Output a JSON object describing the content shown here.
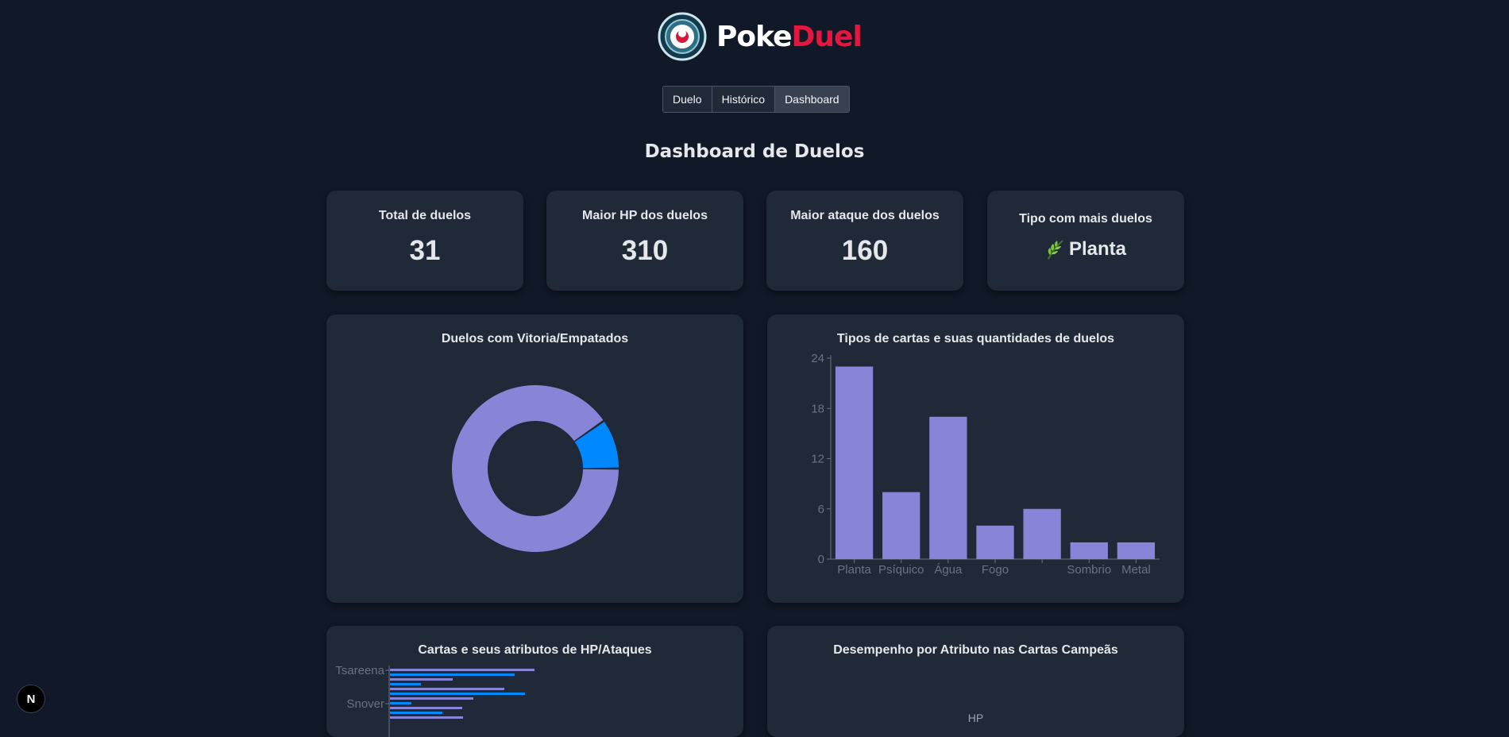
{
  "brand": {
    "poke": "Poke",
    "duel": "Duel"
  },
  "nav": {
    "tabs": [
      "Duelo",
      "Histórico",
      "Dashboard"
    ],
    "active": "Dashboard"
  },
  "page_title": "Dashboard de Duelos",
  "stats": {
    "total_label": "Total de duelos",
    "total_value": "31",
    "hp_label": "Maior HP dos duelos",
    "hp_value": "310",
    "attack_label": "Maior ataque dos duelos",
    "attack_value": "160",
    "type_label": "Tipo com mais duelos",
    "type_value": "Planta",
    "type_icon": "leaf-icon"
  },
  "charts": {
    "donut_title": "Duelos com Vitoria/Empatados",
    "bar_title": "Tipos de cartas e suas quantidades de duelos",
    "hbar_title": "Cartas e seus atributos de HP/Ataques",
    "radar_title": "Desempenho por Atributo nas Cartas Campeãs",
    "radar_axis_label": "HP"
  },
  "colors": {
    "primary": "#8884d8",
    "secondary": "#0088fe",
    "accent": "#e5173f",
    "card_bg": "#1f2937",
    "page_bg": "#111827"
  },
  "chart_data": [
    {
      "type": "pie",
      "title": "Duelos com Vitoria/Empatados",
      "slices": [
        {
          "value": 28
        },
        {
          "value": 3
        }
      ],
      "colors": [
        "#8884d8",
        "#0088fe"
      ],
      "donut": true
    },
    {
      "type": "bar",
      "title": "Tipos de cartas e suas quantidades de duelos",
      "categories": [
        "Planta",
        "Psíquico",
        "Água",
        "Fogo",
        "",
        "Sombrio",
        "Metal"
      ],
      "values": [
        23,
        8,
        17,
        4,
        6,
        2,
        2
      ],
      "yticks": [
        "0",
        "6",
        "12",
        "18",
        "24"
      ],
      "ylim": [
        0,
        24
      ],
      "color": "#8884d8"
    },
    {
      "type": "bar",
      "orientation": "horizontal",
      "title": "Cartas e seus atributos de HP/Ataques",
      "ylabels": [
        "Tsareena",
        "Snover"
      ],
      "colors": [
        "#8884d8",
        "#0088fe"
      ]
    }
  ]
}
